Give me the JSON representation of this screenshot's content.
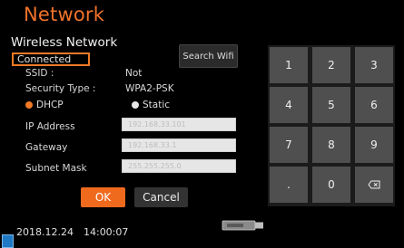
{
  "header": {
    "title": "Network",
    "subtitle": "Wireless Network"
  },
  "status": "Connected",
  "ssid": {
    "label": "SSID :",
    "value": "Not"
  },
  "security": {
    "label": "Security Type :",
    "value": "WPA2-PSK"
  },
  "search_label": "Search Wifi",
  "ip_mode": {
    "dhcp": "DHCP",
    "static": "Static",
    "selected": "DHCP"
  },
  "fields": {
    "ip": {
      "label": "IP Address",
      "value": "192.168.33.101"
    },
    "gateway": {
      "label": "Gateway",
      "value": "192.168.33.1"
    },
    "subnet": {
      "label": "Subnet Mask",
      "value": "255.255.255.0"
    }
  },
  "buttons": {
    "ok": "OK",
    "cancel": "Cancel"
  },
  "footer": {
    "date": "2018.12.24",
    "time": "14:00:07"
  },
  "keypad": {
    "keys": [
      "1",
      "2",
      "3",
      "4",
      "5",
      "6",
      "7",
      "8",
      "9",
      ".",
      "0"
    ],
    "backspace": "backspace-icon"
  },
  "colors": {
    "accent": "#f07a25",
    "background": "#000000",
    "key": "#4f4f4f"
  }
}
